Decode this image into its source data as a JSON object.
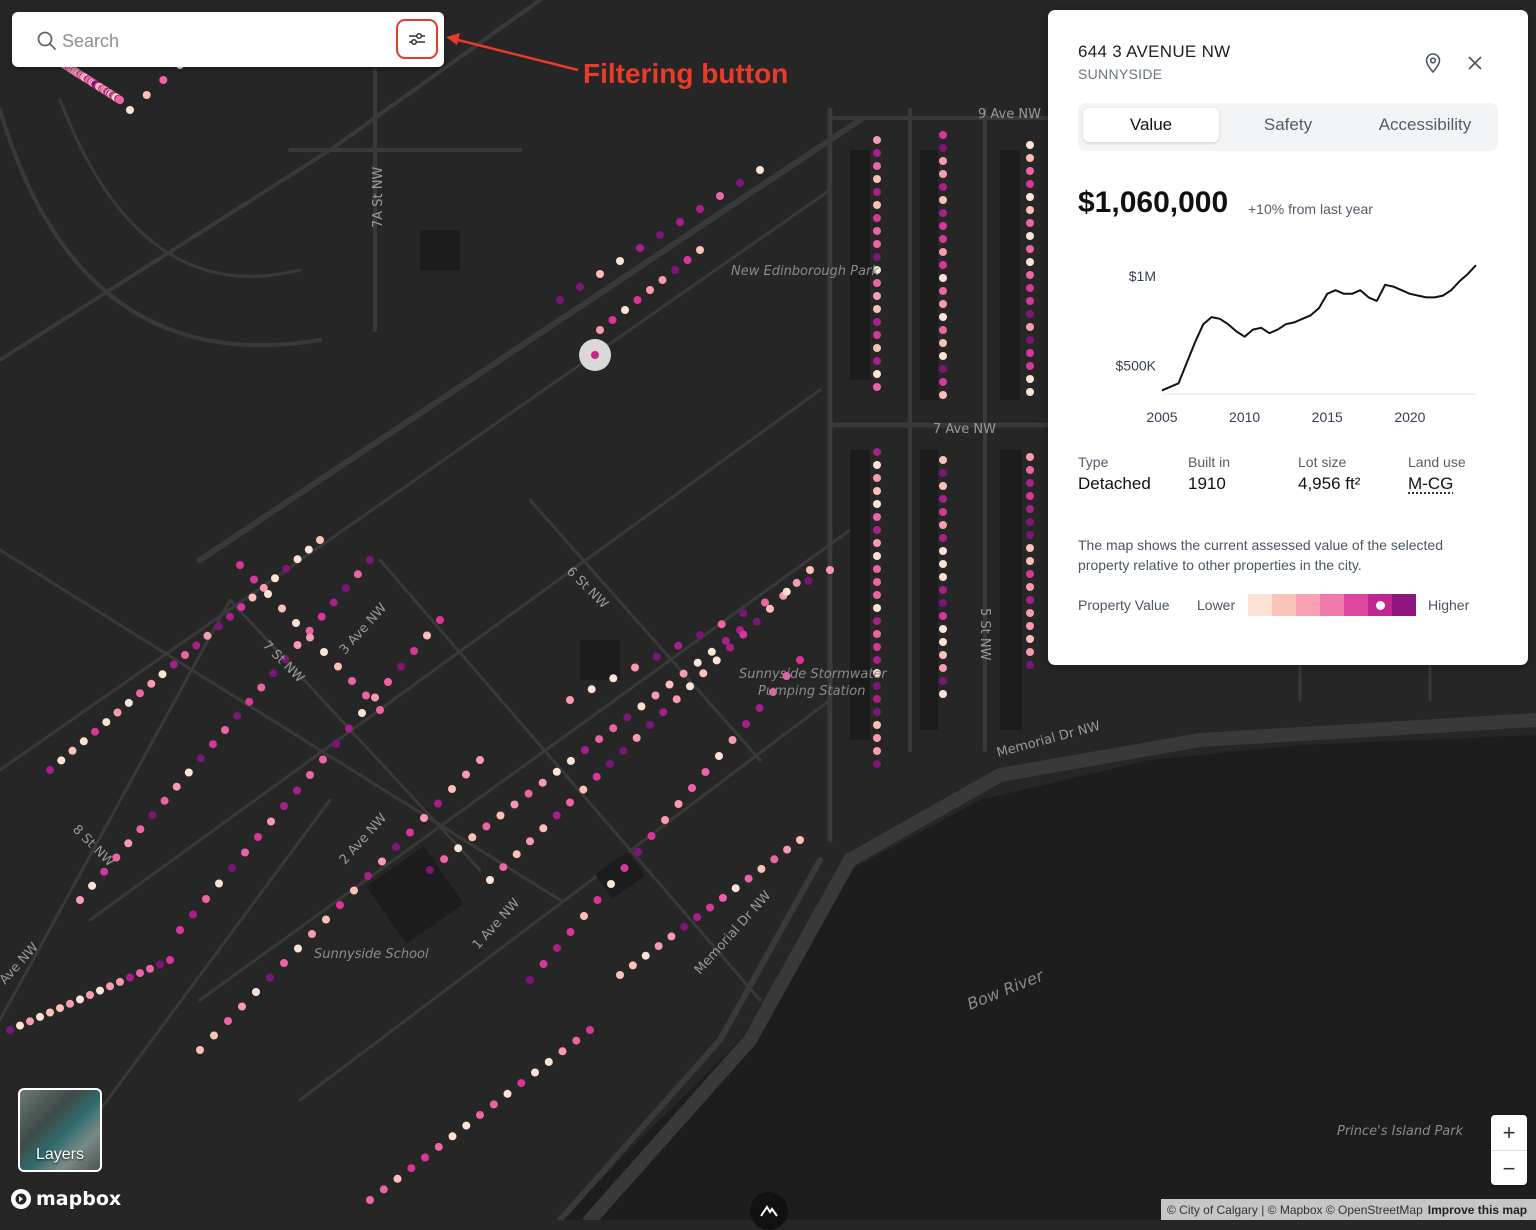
{
  "search": {
    "placeholder": "Search"
  },
  "annotation": {
    "label": "Filtering button",
    "color": "#e83b2a"
  },
  "map": {
    "labels": {
      "ave9": "9 Ave NW",
      "ave7": "7 Ave NW",
      "ave3": "3 Ave NW",
      "ave2": "2 Ave NW",
      "ave1": "1 Ave NW",
      "aveEdge": "Ave NW",
      "st7a": "7A St NW",
      "st7": "7 St NW",
      "st6": "6 St NW",
      "st5": "5 St NW",
      "st8": "8 St NW",
      "memorial1": "Memorial Dr NW",
      "memorial2": "Memorial Dr NW",
      "park": "New Edinborough Park",
      "stormwater1": "Sunnyside Stormwater",
      "stormwater2": "Pumping Station",
      "school": "Sunnyside School",
      "river": "Bow River",
      "princes": "Prince's Island Park"
    },
    "colors": {
      "background": "#262626",
      "river": "#1e1e1e",
      "roads": "#3a3a3a",
      "buildings": "#1d1d1d"
    },
    "value_colors": [
      "#fde3d6",
      "#fbc0b6",
      "#f79bb0",
      "#ee63a6",
      "#d8369b",
      "#a81f88",
      "#7b1677"
    ]
  },
  "panel": {
    "address": "644 3 AVENUE NW",
    "neighbourhood": "SUNNYSIDE",
    "tabs": [
      "Value",
      "Safety",
      "Accessibility"
    ],
    "active_tab": "Value",
    "price": "$1,060,000",
    "change": "+10% from last year",
    "facts": [
      {
        "key": "Type",
        "value": "Detached"
      },
      {
        "key": "Built in",
        "value": "1910"
      },
      {
        "key": "Lot size",
        "value": "4,956 ft²"
      },
      {
        "key": "Land use",
        "value": "M-CG"
      }
    ],
    "description": "The map shows the current assessed value of the selected property relative to other properties in the city.",
    "legend": {
      "title": "Property Value",
      "low": "Lower",
      "high": "Higher",
      "colors": [
        "#fde3d6",
        "#fbc4bb",
        "#f8a2b3",
        "#f07aab",
        "#de47a0",
        "#c02590",
        "#8e1480"
      ],
      "marker_index": 5
    }
  },
  "chart_data": {
    "type": "line",
    "xlabel": "",
    "ylabel": "",
    "xticks": [
      "2005",
      "2010",
      "2015",
      "2020"
    ],
    "yticks": [
      "$500K",
      "$1M"
    ],
    "xlim": [
      2005,
      2024
    ],
    "ylim": [
      340000,
      1100000
    ],
    "x": [
      2005,
      2006,
      2007,
      2007.5,
      2008,
      2008.5,
      2009,
      2009.5,
      2010,
      2010.5,
      2011,
      2011.5,
      2012,
      2012.5,
      2013,
      2013.5,
      2014,
      2014.5,
      2015,
      2015.5,
      2016,
      2016.5,
      2017,
      2017.5,
      2018,
      2018.5,
      2019,
      2019.5,
      2020,
      2020.5,
      2021,
      2021.5,
      2022,
      2022.5,
      2023,
      2023.5,
      2024
    ],
    "series": [
      {
        "values": [
          360000,
          400000,
          630000,
          730000,
          770000,
          760000,
          730000,
          690000,
          660000,
          700000,
          710000,
          680000,
          700000,
          730000,
          740000,
          760000,
          780000,
          820000,
          900000,
          920000,
          900000,
          900000,
          920000,
          880000,
          860000,
          950000,
          940000,
          920000,
          900000,
          890000,
          880000,
          880000,
          890000,
          920000,
          970000,
          1010000,
          1060000
        ]
      }
    ]
  },
  "layers": {
    "label": "Layers"
  },
  "brand": {
    "name": "mapbox"
  },
  "zoom": {
    "in": "+",
    "out": "−"
  },
  "attribution": {
    "text": "© City of Calgary | © Mapbox © OpenStreetMap",
    "improve": "Improve this map"
  }
}
